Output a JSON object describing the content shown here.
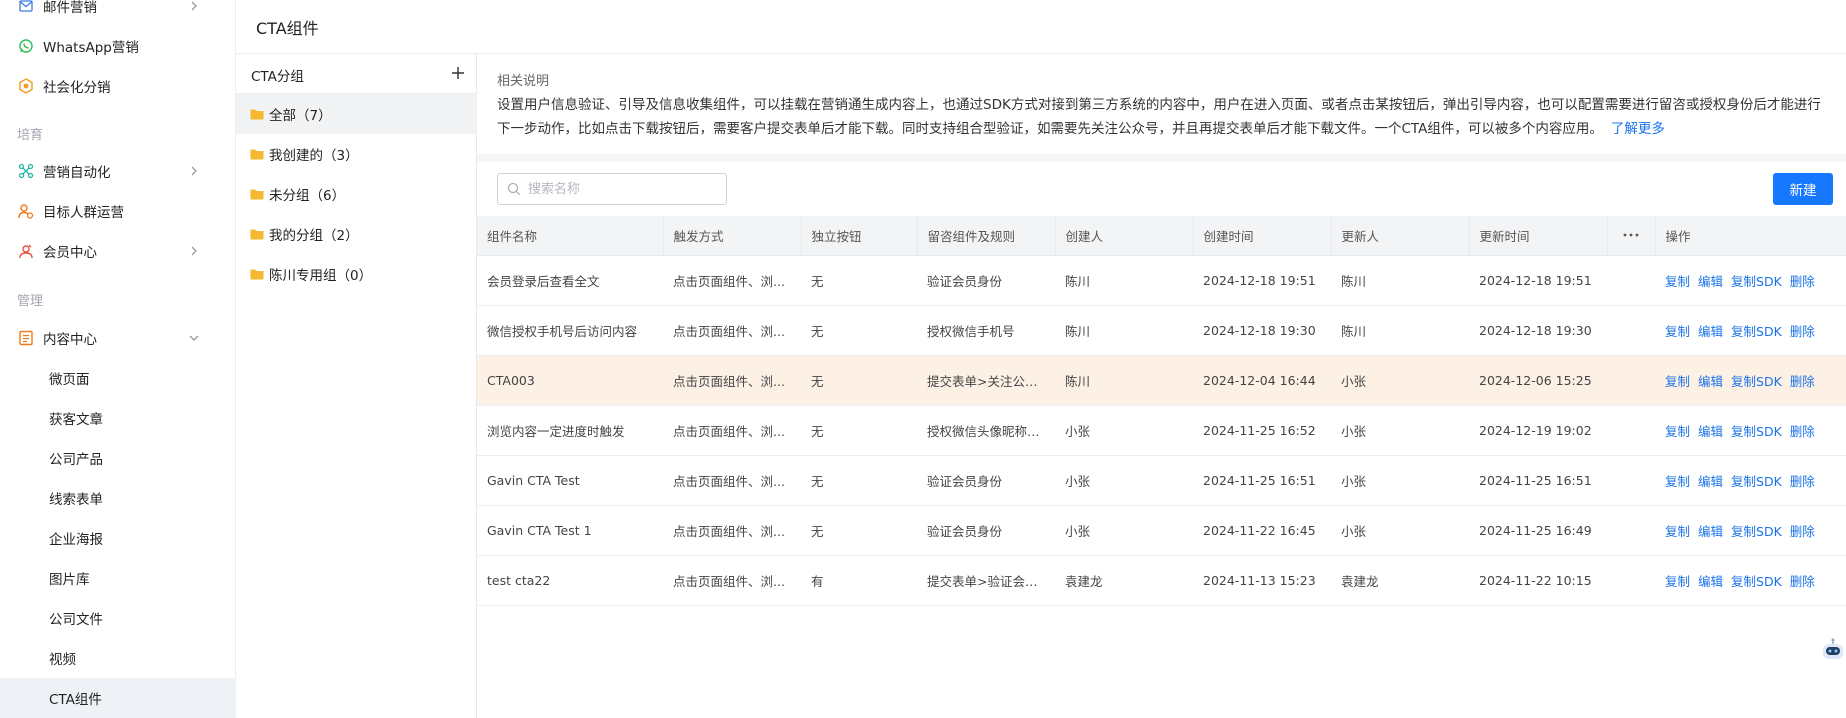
{
  "nav": {
    "items_top": [
      {
        "label": "邮件营销",
        "icon": "mail-icon",
        "has_chevron": true
      },
      {
        "label": "WhatsApp营销",
        "icon": "whatsapp-icon",
        "has_chevron": false
      },
      {
        "label": "社会化分销",
        "icon": "distribution-icon",
        "has_chevron": false
      }
    ],
    "section_nurture": "培育",
    "items_nurture": [
      {
        "label": "营销自动化",
        "icon": "automation-icon",
        "has_chevron": true
      },
      {
        "label": "目标人群运营",
        "icon": "audience-icon",
        "has_chevron": false
      },
      {
        "label": "会员中心",
        "icon": "member-icon",
        "has_chevron": true
      }
    ],
    "section_manage": "管理",
    "content_center": {
      "label": "内容中心",
      "icon": "content-icon",
      "expanded": true
    },
    "sub_items": [
      "微页面",
      "获客文章",
      "公司产品",
      "线索表单",
      "企业海报",
      "图片库",
      "公司文件",
      "视频",
      "CTA组件"
    ],
    "active_sub": "CTA组件"
  },
  "header": {
    "title": "CTA组件"
  },
  "groups": {
    "title": "CTA分组",
    "items": [
      {
        "label": "全部（7）",
        "active": true
      },
      {
        "label": "我创建的（3）",
        "active": false
      },
      {
        "label": "未分组（6）",
        "active": false
      },
      {
        "label": "我的分组（2）",
        "active": false
      },
      {
        "label": "陈川专用组（0）",
        "active": false
      }
    ]
  },
  "description": {
    "title": "相关说明",
    "text": "设置用户信息验证、引导及信息收集组件，可以挂载在营销通生成内容上，也通过SDK方式对接到第三方系统的内容中，用户在进入页面、或者点击某按钮后，弹出引导内容，也可以配置需要进行留咨或授权身份后才能进行下一步动作，比如点击下载按钮后，需要客户提交表单后才能下载。同时支持组合型验证，如需要先关注公众号，并且再提交表单后才能下载文件。一个CTA组件，可以被多个内容应用。",
    "link": "了解更多"
  },
  "toolbar": {
    "search_placeholder": "搜索名称",
    "new_label": "新建"
  },
  "table": {
    "columns": [
      "组件名称",
      "触发方式",
      "独立按钮",
      "留咨组件及规则",
      "创建人",
      "创建时间",
      "更新人",
      "更新时间",
      "",
      "操作"
    ],
    "operations": [
      "复制",
      "编辑",
      "复制SDK",
      "删除"
    ],
    "rows": [
      {
        "name": "会员登录后查看全文",
        "trigger": "点击页面组件、浏...",
        "standalone": "无",
        "rule": "验证会员身份",
        "creator": "陈川",
        "created": "2024-12-18 19:51",
        "updater": "陈川",
        "updated": "2024-12-18 19:51",
        "highlight": false
      },
      {
        "name": "微信授权手机号后访问内容",
        "trigger": "点击页面组件、浏...",
        "standalone": "无",
        "rule": "授权微信手机号",
        "creator": "陈川",
        "created": "2024-12-18 19:30",
        "updater": "陈川",
        "updated": "2024-12-18 19:30",
        "highlight": false
      },
      {
        "name": "CTA003",
        "trigger": "点击页面组件、浏...",
        "standalone": "无",
        "rule": "提交表单>关注公众...",
        "creator": "陈川",
        "created": "2024-12-04 16:44",
        "updater": "小张",
        "updated": "2024-12-06 15:25",
        "highlight": true
      },
      {
        "name": "浏览内容一定进度时触发",
        "trigger": "点击页面组件、浏...",
        "standalone": "无",
        "rule": "授权微信头像昵称>...",
        "creator": "小张",
        "created": "2024-11-25 16:52",
        "updater": "小张",
        "updated": "2024-12-19 19:02",
        "highlight": false
      },
      {
        "name": "Gavin CTA Test",
        "trigger": "点击页面组件、浏...",
        "standalone": "无",
        "rule": "验证会员身份",
        "creator": "小张",
        "created": "2024-11-25 16:51",
        "updater": "小张",
        "updated": "2024-11-25 16:51",
        "highlight": false
      },
      {
        "name": "Gavin CTA Test 1",
        "trigger": "点击页面组件、浏...",
        "standalone": "无",
        "rule": "验证会员身份",
        "creator": "小张",
        "created": "2024-11-22 16:45",
        "updater": "小张",
        "updated": "2024-11-25 16:49",
        "highlight": false
      },
      {
        "name": "test cta22",
        "trigger": "点击页面组件、浏...",
        "standalone": "有",
        "rule": "提交表单>验证会员...",
        "creator": "袁建龙",
        "created": "2024-11-13 15:23",
        "updater": "袁建龙",
        "updated": "2024-11-22 10:15",
        "highlight": false
      }
    ]
  },
  "colors": {
    "accent": "#1677ff",
    "link": "#1a73e8",
    "highlight_row": "#fdf1e6",
    "folder": "#f5b82e"
  }
}
